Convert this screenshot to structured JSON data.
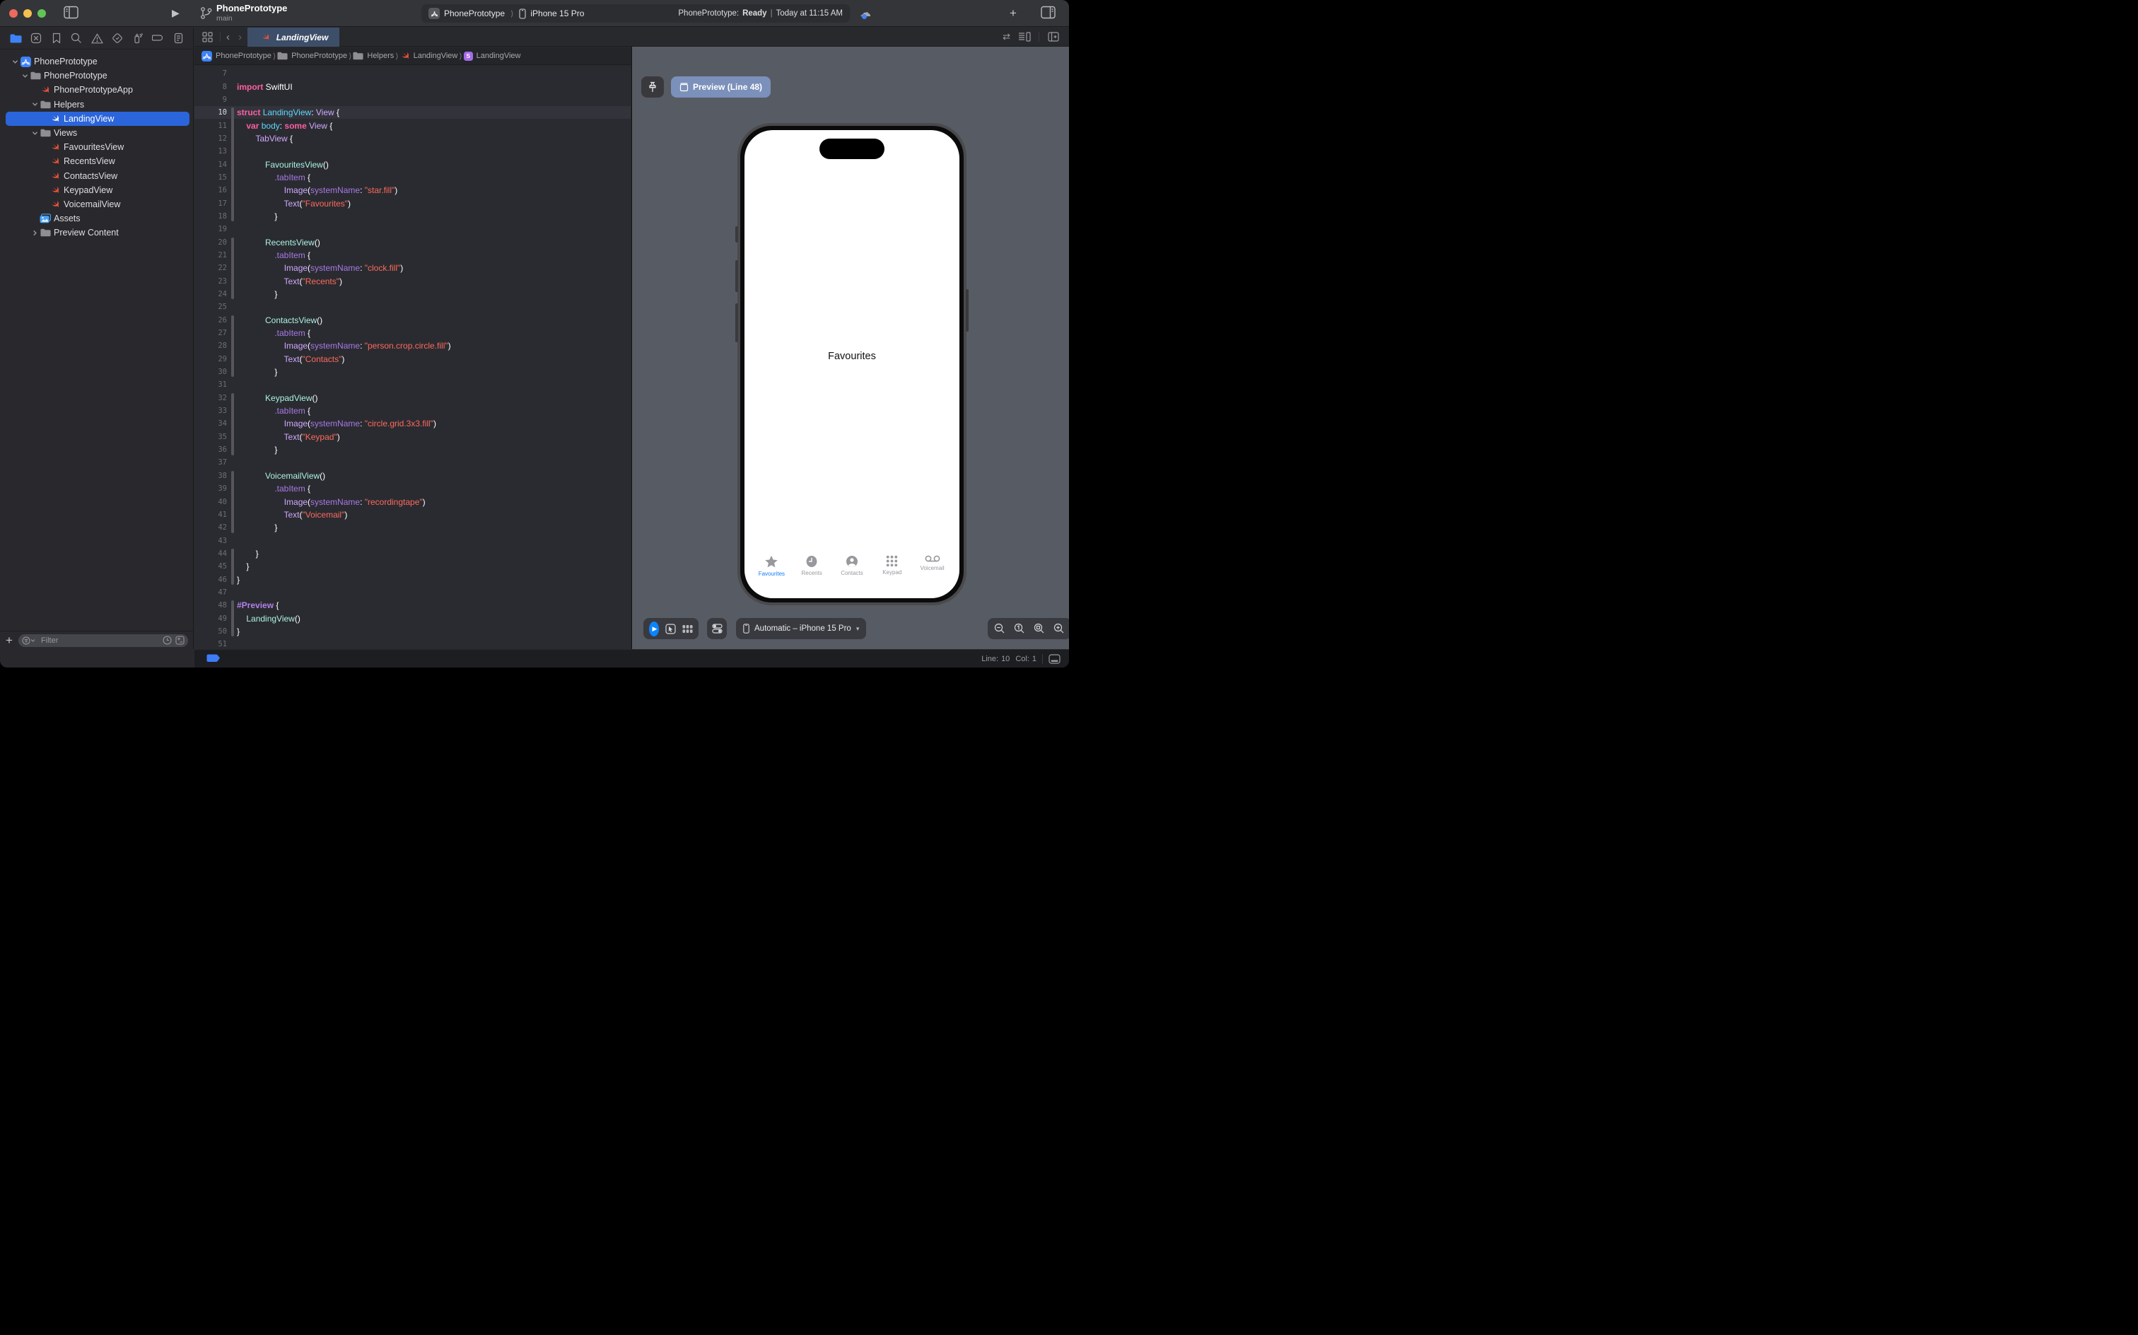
{
  "window": {
    "title": "PhonePrototype",
    "branch": "main",
    "scheme": {
      "project": "PhonePrototype",
      "separator": "⟩",
      "device": "iPhone 15 Pro"
    },
    "status": {
      "project_label": "PhonePrototype:",
      "state": "Ready",
      "separator": "|",
      "time": "Today at 11:15 AM"
    }
  },
  "navigator": {
    "toolbar_icons": [
      "folder",
      "x-square",
      "bookmark",
      "search",
      "warning",
      "check-diamond",
      "spray",
      "capsule",
      "report"
    ],
    "tree": [
      {
        "label": "PhonePrototype",
        "icon": "appstore",
        "level": 0,
        "chevron": "down"
      },
      {
        "label": "PhonePrototype",
        "icon": "folder",
        "level": 1,
        "chevron": "down"
      },
      {
        "label": "PhonePrototypeApp",
        "icon": "swift",
        "level": 2
      },
      {
        "label": "Helpers",
        "icon": "folder",
        "level": 2,
        "chevron": "down"
      },
      {
        "label": "LandingView",
        "icon": "swift",
        "level": 3,
        "selected": true
      },
      {
        "label": "Views",
        "icon": "folder",
        "level": 2,
        "chevron": "down"
      },
      {
        "label": "FavouritesView",
        "icon": "swift",
        "level": 3
      },
      {
        "label": "RecentsView",
        "icon": "swift",
        "level": 3
      },
      {
        "label": "ContactsView",
        "icon": "swift",
        "level": 3
      },
      {
        "label": "KeypadView",
        "icon": "swift",
        "level": 3
      },
      {
        "label": "VoicemailView",
        "icon": "swift",
        "level": 3
      },
      {
        "label": "Assets",
        "icon": "assets",
        "level": 2
      },
      {
        "label": "Preview Content",
        "icon": "folder",
        "level": 2,
        "chevron": "right"
      }
    ],
    "filter_placeholder": "Filter"
  },
  "editor": {
    "tab_label": "LandingView",
    "breadcrumbs": [
      {
        "label": "PhonePrototype",
        "icon": "appstore"
      },
      {
        "label": "PhonePrototype",
        "icon": "folder"
      },
      {
        "label": "Helpers",
        "icon": "folder"
      },
      {
        "label": "LandingView",
        "icon": "swift"
      },
      {
        "label": "LandingView",
        "icon": "sbadge"
      }
    ],
    "first_line": 7,
    "current_line": 10,
    "change_bars": [
      [
        10,
        18
      ],
      [
        20,
        24
      ],
      [
        26,
        30
      ],
      [
        32,
        36
      ],
      [
        38,
        42
      ],
      [
        44,
        46
      ],
      [
        48,
        50
      ]
    ],
    "code": [
      [],
      [
        [
          "k",
          "import"
        ],
        [
          "p",
          " SwiftUI"
        ]
      ],
      [],
      [
        [
          "k",
          "struct"
        ],
        [
          "p",
          " "
        ],
        [
          "d",
          "LandingView"
        ],
        [
          "p",
          ": "
        ],
        [
          "t",
          "View"
        ],
        [
          "p",
          " {"
        ]
      ],
      [
        [
          "p",
          "    "
        ],
        [
          "k",
          "var"
        ],
        [
          "p",
          " "
        ],
        [
          "d",
          "body"
        ],
        [
          "p",
          ": "
        ],
        [
          "k",
          "some"
        ],
        [
          "p",
          " "
        ],
        [
          "t",
          "View"
        ],
        [
          "p",
          " {"
        ]
      ],
      [
        [
          "p",
          "        "
        ],
        [
          "t",
          "TabView"
        ],
        [
          "p",
          " {"
        ]
      ],
      [],
      [
        [
          "p",
          "            "
        ],
        [
          "j",
          "FavouritesView"
        ],
        [
          "p",
          "()"
        ]
      ],
      [
        [
          "p",
          "                "
        ],
        [
          "f",
          ".tabItem"
        ],
        [
          "p",
          " {"
        ]
      ],
      [
        [
          "p",
          "                    "
        ],
        [
          "t",
          "Image"
        ],
        [
          "p",
          "("
        ],
        [
          "f",
          "systemName"
        ],
        [
          "p",
          ": "
        ],
        [
          "s",
          "\"star.fill\""
        ],
        [
          "p",
          ")"
        ]
      ],
      [
        [
          "p",
          "                    "
        ],
        [
          "t",
          "Text"
        ],
        [
          "p",
          "("
        ],
        [
          "s",
          "\"Favourites\""
        ],
        [
          "p",
          ")"
        ]
      ],
      [
        [
          "p",
          "                }"
        ]
      ],
      [],
      [
        [
          "p",
          "            "
        ],
        [
          "j",
          "RecentsView"
        ],
        [
          "p",
          "()"
        ]
      ],
      [
        [
          "p",
          "                "
        ],
        [
          "f",
          ".tabItem"
        ],
        [
          "p",
          " {"
        ]
      ],
      [
        [
          "p",
          "                    "
        ],
        [
          "t",
          "Image"
        ],
        [
          "p",
          "("
        ],
        [
          "f",
          "systemName"
        ],
        [
          "p",
          ": "
        ],
        [
          "s",
          "\"clock.fill\""
        ],
        [
          "p",
          ")"
        ]
      ],
      [
        [
          "p",
          "                    "
        ],
        [
          "t",
          "Text"
        ],
        [
          "p",
          "("
        ],
        [
          "s",
          "\"Recents\""
        ],
        [
          "p",
          ")"
        ]
      ],
      [
        [
          "p",
          "                }"
        ]
      ],
      [],
      [
        [
          "p",
          "            "
        ],
        [
          "j",
          "ContactsView"
        ],
        [
          "p",
          "()"
        ]
      ],
      [
        [
          "p",
          "                "
        ],
        [
          "f",
          ".tabItem"
        ],
        [
          "p",
          " {"
        ]
      ],
      [
        [
          "p",
          "                    "
        ],
        [
          "t",
          "Image"
        ],
        [
          "p",
          "("
        ],
        [
          "f",
          "systemName"
        ],
        [
          "p",
          ": "
        ],
        [
          "s",
          "\"person.crop.circle.fill\""
        ],
        [
          "p",
          ")"
        ]
      ],
      [
        [
          "p",
          "                    "
        ],
        [
          "t",
          "Text"
        ],
        [
          "p",
          "("
        ],
        [
          "s",
          "\"Contacts\""
        ],
        [
          "p",
          ")"
        ]
      ],
      [
        [
          "p",
          "                }"
        ]
      ],
      [],
      [
        [
          "p",
          "            "
        ],
        [
          "j",
          "KeypadView"
        ],
        [
          "p",
          "()"
        ]
      ],
      [
        [
          "p",
          "                "
        ],
        [
          "f",
          ".tabItem"
        ],
        [
          "p",
          " {"
        ]
      ],
      [
        [
          "p",
          "                    "
        ],
        [
          "t",
          "Image"
        ],
        [
          "p",
          "("
        ],
        [
          "f",
          "systemName"
        ],
        [
          "p",
          ": "
        ],
        [
          "s",
          "\"circle.grid.3x3.fill\""
        ],
        [
          "p",
          ")"
        ]
      ],
      [
        [
          "p",
          "                    "
        ],
        [
          "t",
          "Text"
        ],
        [
          "p",
          "("
        ],
        [
          "s",
          "\"Keypad\""
        ],
        [
          "p",
          ")"
        ]
      ],
      [
        [
          "p",
          "                }"
        ]
      ],
      [],
      [
        [
          "p",
          "            "
        ],
        [
          "j",
          "VoicemailView"
        ],
        [
          "p",
          "()"
        ]
      ],
      [
        [
          "p",
          "                "
        ],
        [
          "f",
          ".tabItem"
        ],
        [
          "p",
          " {"
        ]
      ],
      [
        [
          "p",
          "                    "
        ],
        [
          "t",
          "Image"
        ],
        [
          "p",
          "("
        ],
        [
          "f",
          "systemName"
        ],
        [
          "p",
          ": "
        ],
        [
          "s",
          "\"recordingtape\""
        ],
        [
          "p",
          ")"
        ]
      ],
      [
        [
          "p",
          "                    "
        ],
        [
          "t",
          "Text"
        ],
        [
          "p",
          "("
        ],
        [
          "s",
          "\"Voicemail\""
        ],
        [
          "p",
          ")"
        ]
      ],
      [
        [
          "p",
          "                }"
        ]
      ],
      [],
      [
        [
          "p",
          "        }"
        ]
      ],
      [
        [
          "p",
          "    }"
        ]
      ],
      [
        [
          "p",
          "}"
        ]
      ],
      [],
      [
        [
          "m",
          "#Preview"
        ],
        [
          "p",
          " {"
        ]
      ],
      [
        [
          "p",
          "    "
        ],
        [
          "j",
          "LandingView"
        ],
        [
          "p",
          "()"
        ]
      ],
      [
        [
          "p",
          "}"
        ]
      ],
      []
    ],
    "status": {
      "line_label": "Line:",
      "line": "10",
      "col_label": "Col:",
      "col": "1"
    }
  },
  "canvas": {
    "preview_button": "Preview (Line 48)",
    "device_picker": "Automatic – iPhone 15 Pro",
    "zoom_controls": [
      "zoom-out",
      "zoom-actual",
      "zoom-fit",
      "zoom-in"
    ],
    "phone": {
      "center_text": "Favourites",
      "tabs": [
        {
          "label": "Favourites",
          "icon": "star",
          "active": true
        },
        {
          "label": "Recents",
          "icon": "clock"
        },
        {
          "label": "Contacts",
          "icon": "person"
        },
        {
          "label": "Keypad",
          "icon": "keypad"
        },
        {
          "label": "Voicemail",
          "icon": "voicemail"
        }
      ]
    }
  },
  "colors": {
    "accent_blue": "#0a84ff",
    "selection_blue": "#2b65db",
    "phone_tab_active": "#127cf8",
    "phone_tab_inactive": "#97999e",
    "canvas_bg": "#575b63",
    "editor_bg": "#2a2b30",
    "syntax": {
      "keyword": "#fc5fa3",
      "declaration": "#5dd8ff",
      "framework_type": "#d0a8ff",
      "project_type": "#acf2e4",
      "framework_member": "#a779e6",
      "string": "#fc6a5d",
      "macro": "#b281eb"
    }
  }
}
